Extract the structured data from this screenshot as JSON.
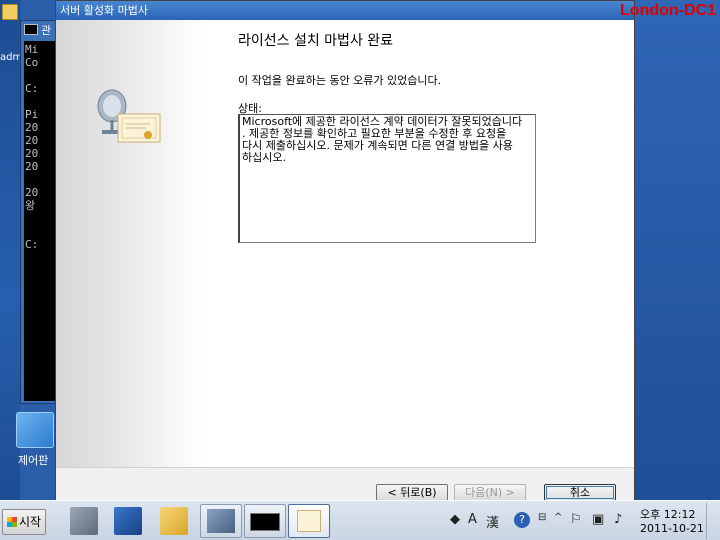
{
  "server_label": "London-DC1",
  "desktop": {
    "left_label": "adm",
    "control_panel_label": "제어판"
  },
  "cmd_window": {
    "title": "관",
    "lines": [
      "Mi",
      "Co",
      "",
      "C:",
      "",
      "Pi",
      "20",
      "20",
      "20",
      "20",
      "",
      "20",
      "왕",
      "",
      "",
      "C:"
    ]
  },
  "wizard": {
    "title": "서버 활성화 마법사",
    "page_title": "라이선스 설치 마법사 완료",
    "error_message": "이 작업을 완료하는 동안 오류가 있었습니다.",
    "status_label": "상태:",
    "status_lines": [
      "Microsoft에 제공한 라이선스 계약 데이터가 잘못되었습니다",
      ". 제공한 정보를 확인하고 필요한 부분을 수정한 후 요청을",
      "다시 제출하십시오. 문제가 계속되면 다른 연결 방법을 사용",
      "하십시오."
    ],
    "buttons": {
      "back": "< 뒤로(B)",
      "next": "다음(N) >",
      "cancel": "취소"
    }
  },
  "taskbar": {
    "start_label": "시작",
    "tray": {
      "ime_mode": "A",
      "hanja": "漢",
      "help": "?",
      "time": "오후 12:12",
      "date": "2011-10-21"
    }
  },
  "icons": {
    "start": "windows-flag-icon",
    "server_manager": "server-manager-icon",
    "powershell": "powershell-icon",
    "explorer": "folder-icon",
    "services": "server-tools-icon",
    "cmd": "command-prompt-icon",
    "license_wizard": "license-certificate-icon"
  }
}
